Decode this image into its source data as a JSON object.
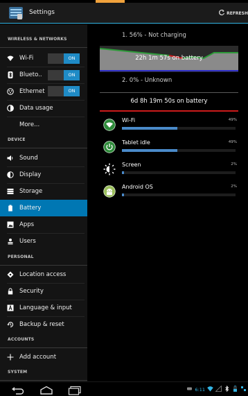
{
  "app": {
    "title": "Settings",
    "refresh_label": "REFRESH"
  },
  "sidebar": {
    "headers": {
      "wireless": "WIRELESS & NETWORKS",
      "device": "DEVICE",
      "personal": "PERSONAL",
      "accounts": "ACCOUNTS",
      "system": "SYSTEM"
    },
    "items": {
      "wifi": "Wi-Fi",
      "bluetooth": "Blueto..",
      "ethernet": "Ethernet",
      "data_usage": "Data usage",
      "more": "More...",
      "sound": "Sound",
      "display": "Display",
      "storage": "Storage",
      "battery": "Battery",
      "apps": "Apps",
      "users": "Users",
      "location": "Location access",
      "security": "Security",
      "language": "Language & input",
      "backup": "Backup & reset",
      "add_account": "Add account"
    },
    "toggle_label": "ON",
    "active_item": "battery"
  },
  "battery": {
    "status_1": "1. 56% - Not charging",
    "graph_label": "22h 1m 57s on battery",
    "status_2": "2. 0% - Unknown",
    "time_on_battery": "6d 8h 19m 50s on battery",
    "usage": [
      {
        "name": "Wi-Fi",
        "percent_label": "49%",
        "fraction": 0.49,
        "icon": "wifi-icon"
      },
      {
        "name": "Tablet idle",
        "percent_label": "49%",
        "fraction": 0.49,
        "icon": "power-icon"
      },
      {
        "name": "Screen",
        "percent_label": "2%",
        "fraction": 0.02,
        "icon": "brightness-icon"
      },
      {
        "name": "Android OS",
        "percent_label": "2%",
        "fraction": 0.02,
        "icon": "android-icon"
      }
    ]
  },
  "status_bar": {
    "time": "6:11"
  },
  "colors": {
    "accent": "#33b5e5",
    "selected": "#0077b3",
    "bar": "#4a8ac9",
    "graph_green": "#2e9a3a",
    "graph_red": "#cc1b1b"
  }
}
